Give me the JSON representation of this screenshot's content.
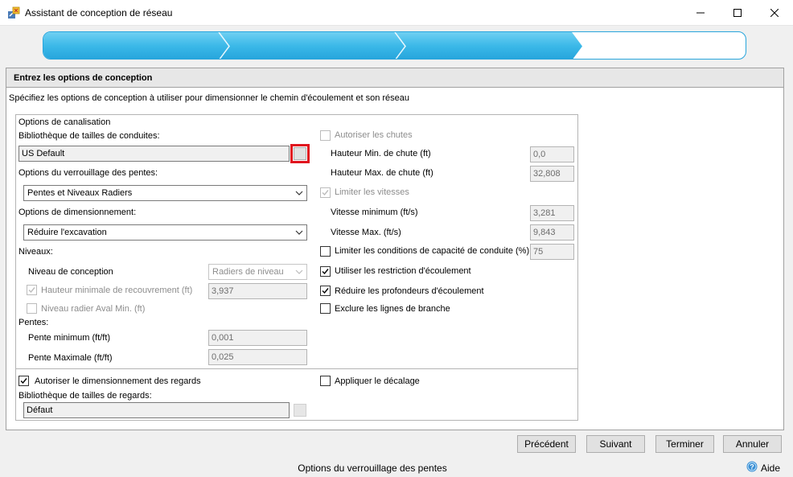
{
  "window": {
    "title": "Assistant de conception de réseau"
  },
  "panel": {
    "header": "Entrez les options de conception",
    "description": "Spécifiez les options de conception à utiliser pour dimensionner le chemin d'écoulement et son réseau"
  },
  "left": {
    "group_title": "Options de canalisation",
    "pipe_library_label": "Bibliothèque de tailles de conduites:",
    "pipe_library_value": "US Default",
    "slope_lock_label": "Options du verrouillage des pentes:",
    "slope_lock_value": "Pentes et Niveaux Radiers",
    "sizing_label": "Options de dimensionnement:",
    "sizing_value": "Réduire l'excavation",
    "levels_label": "Niveaux:",
    "design_level_label": "Niveau de conception",
    "design_level_value": "Radiers de niveau",
    "min_cover_label": "Hauteur minimale de recouvrement (ft)",
    "min_cover_value": "3,937",
    "min_downstream_invert_label": "Niveau radier Aval Min. (ft)",
    "slopes_label": "Pentes:",
    "min_slope_label": "Pente minimum (ft/ft)",
    "min_slope_value": "0,001",
    "max_slope_label": "Pente Maximale (ft/ft)",
    "max_slope_value": "0,025",
    "allow_manhole_sizing_label": "Autoriser le dimensionnement des regards",
    "manhole_library_label": "Bibliothèque de tailles de regards:",
    "manhole_library_value": "Défaut"
  },
  "right": {
    "allow_drops_label": "Autoriser les chutes",
    "min_drop_label": "Hauteur Min. de chute (ft)",
    "min_drop_value": "0,0",
    "max_drop_label": "Hauteur Max. de chute (ft)",
    "max_drop_value": "32,808",
    "limit_velocity_label": "Limiter les vitesses",
    "min_velocity_label": "Vitesse minimum (ft/s)",
    "min_velocity_value": "3,281",
    "max_velocity_label": "Vitesse Max. (ft/s)",
    "max_velocity_value": "9,843",
    "limit_capacity_label": "Limiter les conditions de capacité de conduite (%)",
    "limit_capacity_value": "75",
    "use_flow_restriction_label": "Utiliser les restriction d'écoulement",
    "reduce_flow_depth_label": "Réduire les profondeurs d'écoulement",
    "exclude_branch_label": "Exclure les lignes de branche",
    "apply_offset_label": "Appliquer le décalage"
  },
  "checkboxes": {
    "allow_drops": false,
    "limit_velocity": true,
    "limit_capacity": false,
    "use_flow_restriction": true,
    "reduce_flow_depth": true,
    "exclude_branch": false,
    "min_cover": true,
    "min_downstream_invert": false,
    "allow_manhole_sizing": true,
    "apply_offset": false
  },
  "progress": {
    "completed_steps": 3,
    "total_steps": 4
  },
  "buttons": {
    "previous": "Précédent",
    "next": "Suivant",
    "finish": "Terminer",
    "cancel": "Annuler"
  },
  "status": {
    "text": "Options du verrouillage des pentes",
    "help": "Aide"
  },
  "colors": {
    "accent": "#28a5dc",
    "highlight": "#e0141e"
  }
}
